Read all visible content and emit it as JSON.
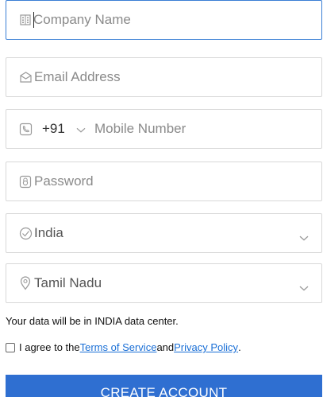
{
  "fields": {
    "company": {
      "placeholder": "Company Name",
      "icon": "building-icon"
    },
    "email": {
      "placeholder": "Email Address",
      "icon": "envelope-icon"
    },
    "mobile": {
      "code": "+91",
      "placeholder": "Mobile Number",
      "icon": "phone-icon"
    },
    "password": {
      "placeholder": "Password",
      "icon": "lock-icon"
    },
    "country": {
      "value": "India",
      "icon": "globe-icon"
    },
    "state": {
      "value": "Tamil Nadu",
      "icon": "location-pin-icon"
    }
  },
  "datacenter_note": "Your data will be in INDIA data center.",
  "agreement": {
    "prefix": "I agree to the",
    "terms_link": "Terms of Service",
    "and": "and",
    "privacy_link": "Privacy Policy",
    "suffix": "."
  },
  "create_button_label": "CREATE ACCOUNT",
  "colors": {
    "accent": "#2f6fd1",
    "focus_border": "#3a7fd5",
    "link": "#1a6fd6",
    "border": "#d8d8d8",
    "placeholder": "#8a8a8a"
  }
}
